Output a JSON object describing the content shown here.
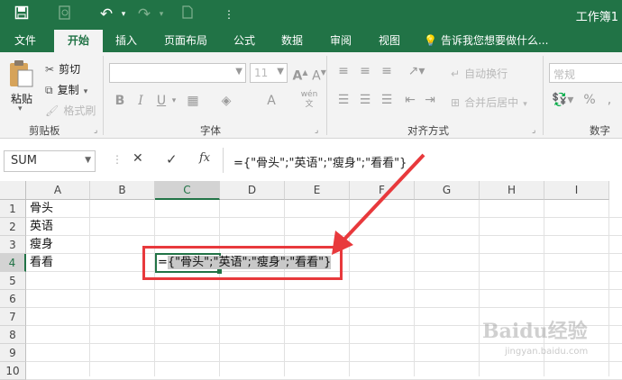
{
  "window": {
    "title": "工作簿1"
  },
  "quick_access": [
    "save-icon",
    "print-preview-icon",
    "undo-icon",
    "redo-icon",
    "new-icon",
    "customize-icon"
  ],
  "tabs": [
    {
      "label": "文件",
      "active": false
    },
    {
      "label": "开始",
      "active": true
    },
    {
      "label": "插入",
      "active": false
    },
    {
      "label": "页面布局",
      "active": false
    },
    {
      "label": "公式",
      "active": false
    },
    {
      "label": "数据",
      "active": false
    },
    {
      "label": "审阅",
      "active": false
    },
    {
      "label": "视图",
      "active": false
    }
  ],
  "tell_me": "告诉我您想要做什么...",
  "ribbon": {
    "clipboard": {
      "paste": "粘贴",
      "cut": "剪切",
      "copy": "复制",
      "format_painter": "格式刷",
      "label": "剪贴板"
    },
    "font": {
      "font_name": "",
      "font_size": "11",
      "bold": "B",
      "italic": "I",
      "underline": "U",
      "label": "字体"
    },
    "alignment": {
      "wrap_text": "自动换行",
      "merge_center": "合并后居中",
      "label": "对齐方式"
    },
    "number": {
      "format": "常规",
      "percent": "%",
      "label": "数字"
    }
  },
  "formula_bar": {
    "name_box": "SUM",
    "cancel": "✕",
    "enter": "✓",
    "fx": "fx",
    "formula": "={\"骨头\";\"英语\";\"瘦身\";\"看看\"}"
  },
  "grid": {
    "columns": [
      "A",
      "B",
      "C",
      "D",
      "E",
      "F",
      "G",
      "H",
      "I"
    ],
    "rows": [
      "1",
      "2",
      "3",
      "4",
      "5",
      "6",
      "7",
      "8",
      "9",
      "10"
    ],
    "selected_column": "C",
    "selected_row": "4",
    "cells": {
      "A1": "骨头",
      "A2": "英语",
      "A3": "瘦身",
      "A4": "看看",
      "C4_prefix": "=",
      "C4_selected": "{\"骨头\";\"英语\";\"瘦身\";\"看看\"}"
    }
  },
  "colors": {
    "excel_green": "#217346",
    "annotation_red": "#e8393c"
  },
  "watermark": {
    "brand": "Baidu经验",
    "url": "jingyan.baidu.com"
  }
}
